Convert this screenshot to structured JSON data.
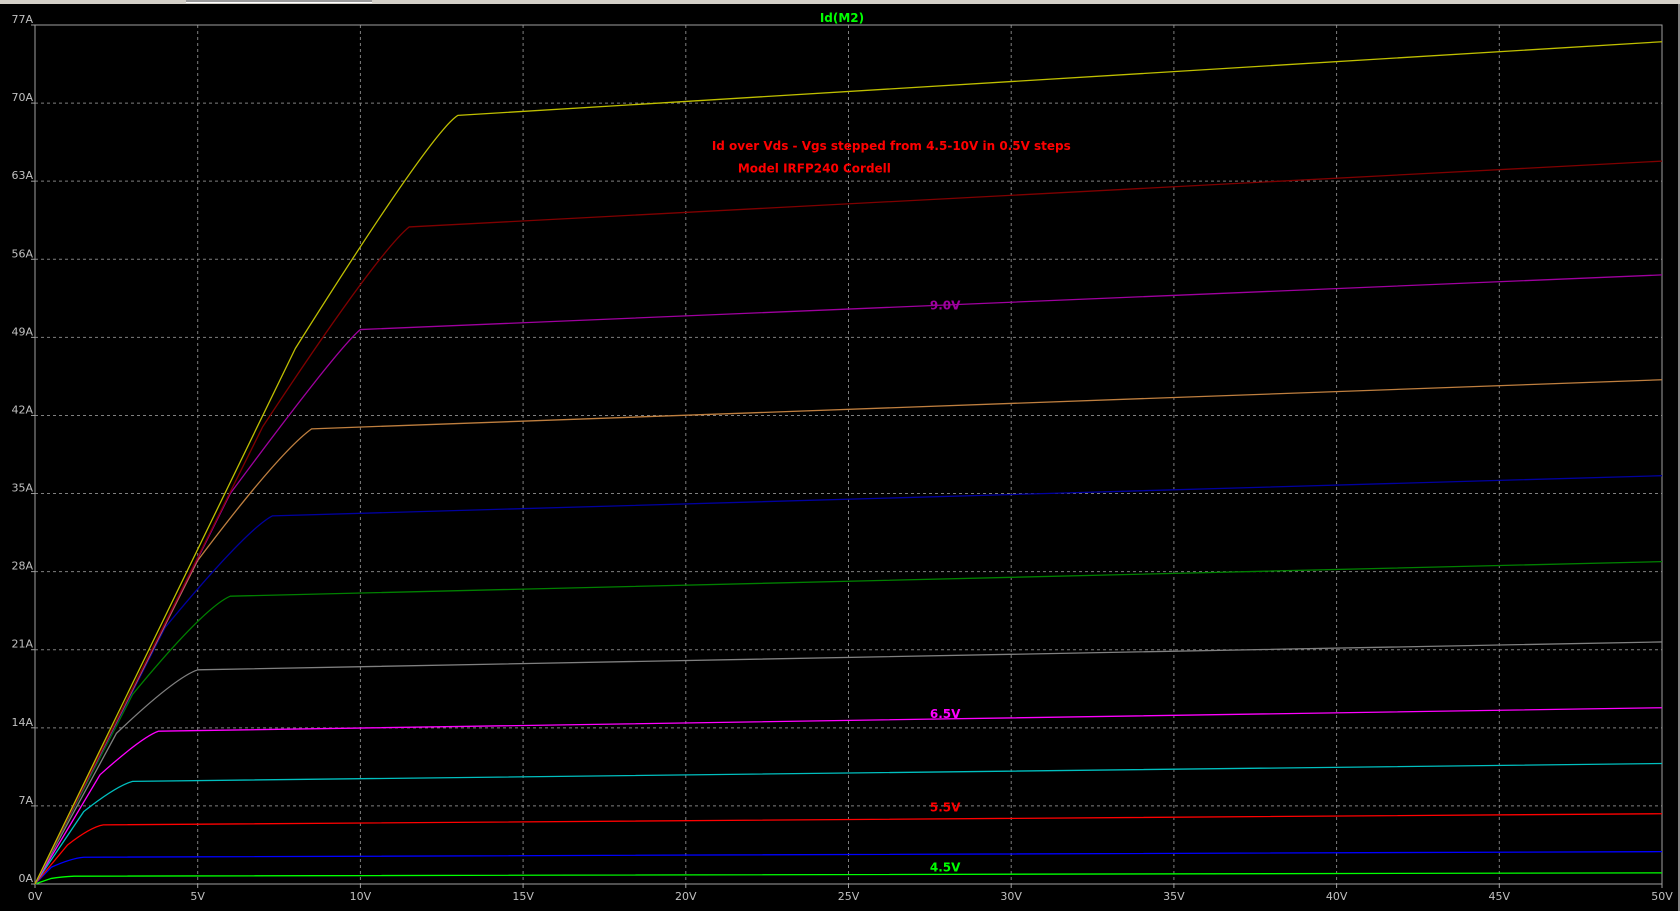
{
  "window": {
    "background": "#000000",
    "grid_color": "#7f7f7f",
    "text_color": "#c0c0c0"
  },
  "chart_data": {
    "type": "line",
    "title": "Id(M2)",
    "title_color": "#00ff00",
    "xlabel": "",
    "ylabel": "",
    "xlim": [
      0,
      50
    ],
    "ylim": [
      0,
      77
    ],
    "grid": true,
    "x_ticks": [
      "0V",
      "5V",
      "10V",
      "15V",
      "20V",
      "25V",
      "30V",
      "35V",
      "40V",
      "45V",
      "50V"
    ],
    "x_tick_values": [
      0,
      5,
      10,
      15,
      20,
      25,
      30,
      35,
      40,
      45,
      50
    ],
    "y_ticks": [
      "0A",
      "7A",
      "14A",
      "21A",
      "28A",
      "35A",
      "42A",
      "49A",
      "56A",
      "63A",
      "70A",
      "77A"
    ],
    "y_tick_values": [
      0,
      7,
      14,
      21,
      28,
      35,
      42,
      49,
      56,
      63,
      70,
      77
    ],
    "series": [
      {
        "x": [
          0,
          0.5,
          0.8,
          1.2,
          50
        ],
        "y": [
          0,
          0.5,
          0.65,
          0.7,
          1.0
        ],
        "color": "#00ff00"
      },
      {
        "x": [
          0,
          0.5,
          1.1,
          1.5,
          50
        ],
        "y": [
          0,
          1.5,
          2.3,
          2.4,
          2.9
        ],
        "color": "#0000ff"
      },
      {
        "x": [
          0,
          1.0,
          1.7,
          2.1,
          50
        ],
        "y": [
          0,
          3.5,
          5.1,
          5.3,
          6.3
        ],
        "color": "#ff0000"
      },
      {
        "x": [
          0,
          1.5,
          2.5,
          3.0,
          50
        ],
        "y": [
          0,
          6.5,
          8.8,
          9.2,
          10.8
        ],
        "color": "#00bfbf"
      },
      {
        "x": [
          0,
          2.0,
          3.3,
          3.8,
          50
        ],
        "y": [
          0,
          9.8,
          13.2,
          13.7,
          15.8
        ],
        "color": "#ff00ff"
      },
      {
        "x": [
          0,
          2.5,
          4.3,
          5.0,
          50
        ],
        "y": [
          0,
          13.5,
          18.5,
          19.2,
          21.7
        ],
        "color": "#808080"
      },
      {
        "x": [
          0,
          3.0,
          5.2,
          6.0,
          50
        ],
        "y": [
          0,
          17.0,
          24.8,
          25.8,
          28.9
        ],
        "color": "#008000"
      },
      {
        "x": [
          0,
          4.0,
          6.5,
          7.3,
          50
        ],
        "y": [
          0,
          23.0,
          31.8,
          33.0,
          36.6
        ],
        "color": "#00009f"
      },
      {
        "x": [
          0,
          5.0,
          7.5,
          8.5,
          50
        ],
        "y": [
          0,
          29.0,
          38.7,
          40.8,
          45.2
        ],
        "color": "#bf7f3f"
      },
      {
        "x": [
          0,
          6.0,
          9.3,
          10.0,
          50
        ],
        "y": [
          0,
          35.0,
          48.0,
          49.7,
          54.6
        ],
        "color": "#9f009f"
      },
      {
        "x": [
          0,
          7.0,
          10.5,
          11.5,
          50
        ],
        "y": [
          0,
          41.0,
          56.5,
          58.9,
          64.8
        ],
        "color": "#7f0000"
      },
      {
        "x": [
          0,
          8.0,
          12.2,
          13.0,
          50
        ],
        "y": [
          0,
          48.0,
          67.5,
          68.9,
          75.5
        ],
        "color": "#bfbf00"
      }
    ],
    "annotations": [
      {
        "text": "Id over Vds - Vgs stepped from 4.5-10V in 0.5V steps",
        "x": 20.8,
        "y": 65.8,
        "color": "#ff0000"
      },
      {
        "text": "Model IRFP240 Cordell",
        "x": 21.6,
        "y": 63.8,
        "color": "#ff0000"
      },
      {
        "text": "9.0V",
        "x": 27.5,
        "y": 51.5,
        "color": "#9f009f"
      },
      {
        "text": "6.5V",
        "x": 27.5,
        "y": 14.9,
        "color": "#ff00ff"
      },
      {
        "text": "5.5V",
        "x": 27.5,
        "y": 6.5,
        "color": "#ff0000"
      },
      {
        "text": "4.5V",
        "x": 27.5,
        "y": 1.1,
        "color": "#00ff00"
      }
    ]
  }
}
